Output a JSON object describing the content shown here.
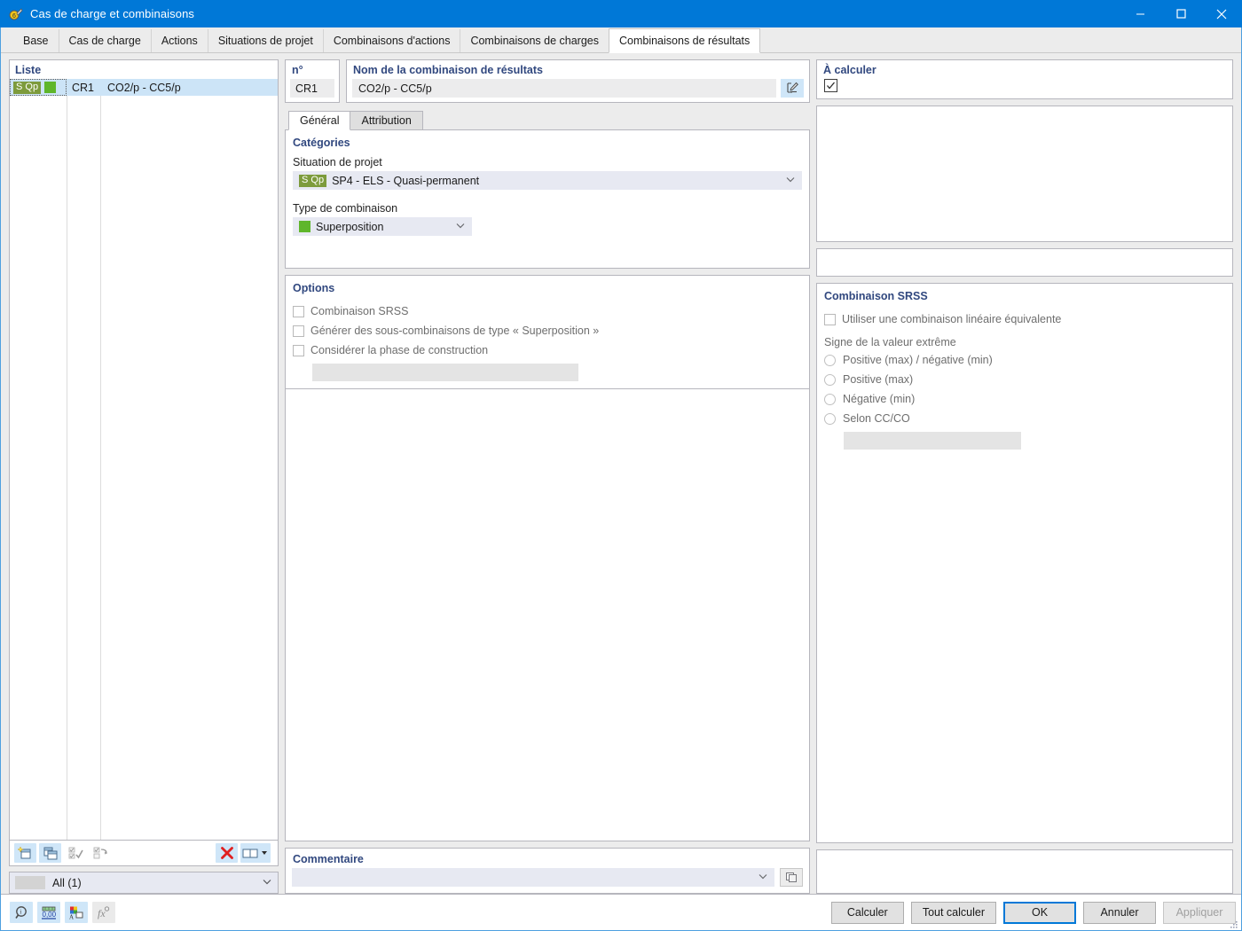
{
  "window": {
    "title": "Cas de charge et combinaisons",
    "icon": "app-icon",
    "minimize_label": "—",
    "maximize_label": "□",
    "close_label": "✕"
  },
  "tabs": [
    {
      "label": "Base",
      "active": false
    },
    {
      "label": "Cas de charge",
      "active": false
    },
    {
      "label": "Actions",
      "active": false
    },
    {
      "label": "Situations de projet",
      "active": false
    },
    {
      "label": "Combinaisons d'actions",
      "active": false
    },
    {
      "label": "Combinaisons de charges",
      "active": false
    },
    {
      "label": "Combinaisons de résultats",
      "active": true
    }
  ],
  "list_panel": {
    "header": "Liste",
    "rows": [
      {
        "badge": "S Qp",
        "swatch_color": "#5fb62b",
        "number": "CR1",
        "name": "CO2/p - CC5/p",
        "selected": true
      }
    ],
    "toolbar": [
      {
        "name": "new-item-button",
        "state": "enabled"
      },
      {
        "name": "duplicate-item-button",
        "state": "enabled"
      },
      {
        "name": "select-all-button",
        "state": "disabled"
      },
      {
        "name": "invert-selection-button",
        "state": "disabled"
      },
      {
        "name": "delete-item-button",
        "state": "enabled"
      },
      {
        "name": "view-mode-button",
        "state": "enabled"
      }
    ],
    "filter": {
      "value": "All (1)"
    }
  },
  "header_fields": {
    "number_label": "n°",
    "number_value": "CR1",
    "name_label": "Nom de la combinaison de résultats",
    "name_value": "CO2/p - CC5/p",
    "edit_button": "edit-pencil-icon"
  },
  "calc_panel": {
    "title": "À calculer",
    "checked": true
  },
  "inner_tabs": [
    {
      "label": "Général",
      "active": true
    },
    {
      "label": "Attribution",
      "active": false
    }
  ],
  "categories": {
    "title": "Catégories",
    "project_situation_label": "Situation de projet",
    "project_situation_badge": "S Qp",
    "project_situation_value": "SP4 - ELS - Quasi-permanent",
    "combination_type_label": "Type de combinaison",
    "combination_type_swatch": "#5fb62b",
    "combination_type_value": "Superposition"
  },
  "options": {
    "title": "Options",
    "items": [
      {
        "label": "Combinaison SRSS",
        "checked": false,
        "disabled": true
      },
      {
        "label": "Générer des sous-combinaisons de type « Superposition »",
        "checked": false,
        "disabled": true
      },
      {
        "label": "Considérer la phase de construction",
        "checked": false,
        "disabled": true
      }
    ],
    "extra_field_value": ""
  },
  "srss": {
    "title": "Combinaison SRSS",
    "use_linear_label": "Utiliser une combinaison linéaire équivalente",
    "use_linear_checked": false,
    "sign_label": "Signe de la valeur extrême",
    "sign_options": [
      {
        "label": "Positive (max) / négative (min)",
        "selected": false
      },
      {
        "label": "Positive (max)",
        "selected": false
      },
      {
        "label": "Négative (min)",
        "selected": false
      },
      {
        "label": "Selon CC/CO",
        "selected": false
      }
    ],
    "extra_field_value": ""
  },
  "comment": {
    "title": "Commentaire",
    "value": "",
    "button": "comment-copy-icon"
  },
  "bottom_bar": {
    "icons": [
      {
        "name": "info-search-icon",
        "state": "enabled"
      },
      {
        "name": "decimal-places-icon",
        "state": "enabled"
      },
      {
        "name": "colors-icon",
        "state": "enabled"
      },
      {
        "name": "formula-icon",
        "state": "disabled"
      }
    ],
    "buttons": [
      {
        "label": "Calculer",
        "style": "normal"
      },
      {
        "label": "Tout calculer",
        "style": "normal"
      },
      {
        "label": "OK",
        "style": "primary"
      },
      {
        "label": "Annuler",
        "style": "normal"
      },
      {
        "label": "Appliquer",
        "style": "disabled"
      }
    ]
  },
  "colors": {
    "title_bar": "#0078d7",
    "accent": "#0078d7",
    "group_title": "#31487f",
    "green": "#5fb62b",
    "badge_olive": "#7d9b3c",
    "selection": "#cce4f7",
    "delete_red": "#e02020"
  }
}
